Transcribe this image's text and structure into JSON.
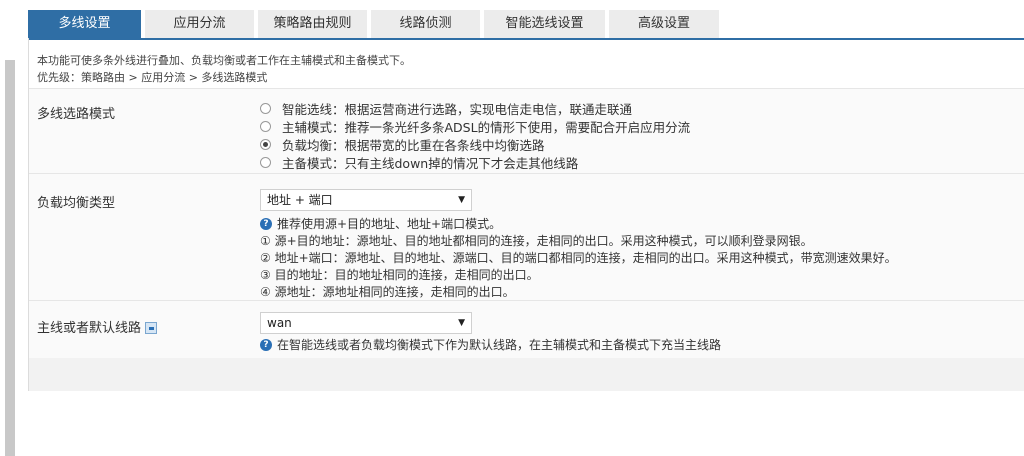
{
  "tabs": [
    {
      "label": "多线设置",
      "active": true
    },
    {
      "label": "应用分流",
      "active": false
    },
    {
      "label": "策略路由规则",
      "active": false
    },
    {
      "label": "线路侦测",
      "active": false
    },
    {
      "label": "智能选线设置",
      "active": false
    },
    {
      "label": "高级设置",
      "active": false
    }
  ],
  "intro": {
    "description": "本功能可使多条外线进行叠加、负载均衡或者工作在主辅模式和主备模式下。",
    "priority": "优先级：策略路由 > 应用分流 > 多线选路模式"
  },
  "mode": {
    "label": "多线选路模式",
    "options": [
      {
        "text": "智能选线：根据运营商进行选路，实现电信走电信，联通走联通",
        "checked": false
      },
      {
        "text": "主辅模式：推荐一条光纤多条ADSL的情形下使用，需要配合开启应用分流",
        "checked": false
      },
      {
        "text": "负载均衡：根据带宽的比重在各条线中均衡选路",
        "checked": true
      },
      {
        "text": "主备模式：只有主线down掉的情况下才会走其他线路",
        "checked": false
      }
    ]
  },
  "balance": {
    "label": "负载均衡类型",
    "selected": "地址 + 端口",
    "help": "推荐使用源+目的地址、地址+端口模式。",
    "notes": [
      "① 源+目的地址：源地址、目的地址都相同的连接，走相同的出口。采用这种模式，可以顺利登录网银。",
      "② 地址+端口：源地址、目的地址、源端口、目的端口都相同的连接，走相同的出口。采用这种模式，带宽测速效果好。",
      "③ 目的地址：目的地址相同的连接，走相同的出口。",
      "④ 源地址：源地址相同的连接，走相同的出口。"
    ]
  },
  "default_line": {
    "label": "主线或者默认线路",
    "selected": "wan",
    "help": "在智能选线或者负载均衡模式下作为默认线路，在主辅模式和主备模式下充当主线路"
  },
  "icons": {
    "caret": "▼",
    "help": "?"
  },
  "colors": {
    "accent": "#2f6ea5",
    "help_icon": "#2a6fb5"
  }
}
